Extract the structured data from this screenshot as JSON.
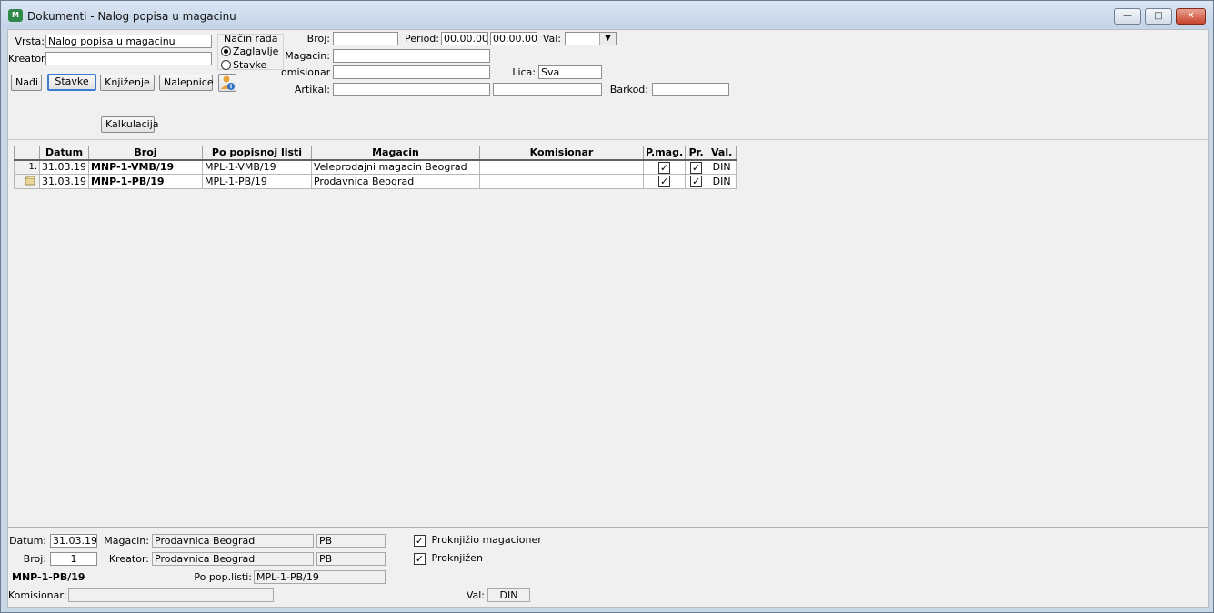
{
  "window": {
    "title": "Dokumenti - Nalog popisa u magacinu",
    "app_icon_text": "M",
    "minimize_symbol": "—",
    "maximize_symbol": "□",
    "close_symbol": "✕"
  },
  "filters": {
    "vrsta_label": "Vrsta:",
    "vrsta_value": "Nalog popisa u magacinu",
    "kreator_label": "Kreator:",
    "kreator_value": "",
    "nacin_rada_label": "Način rada",
    "mode_options": [
      "Zaglavlje",
      "Stavke"
    ],
    "mode_selected": "Zaglavlje",
    "broj_label": "Broj:",
    "broj_value": "",
    "period_label": "Period:",
    "period_from": "00.00.00",
    "period_to": "00.00.00",
    "val_label": "Val:",
    "val_value": "",
    "magacin_label": "Magacin:",
    "magacin_value": "",
    "komisionar_label": "omisionar:",
    "komisionar_value": "",
    "lica_label": "Lica:",
    "lica_value": "Sva",
    "artikal_label": "Artikal:",
    "artikal_value": "",
    "artikal_value2": "",
    "barkod_label": "Barkod:",
    "barkod_value": ""
  },
  "toolbar": {
    "nadji": "Nađi",
    "stavke": "Stavke",
    "knjizenje": "Knjiženje",
    "nalepnice": "Nalepnice",
    "kalkulacija": "Kalkulacija"
  },
  "grid": {
    "columns": [
      "",
      "Datum",
      "Broj",
      "Po popisnoj listi",
      "Magacin",
      "Komisionar",
      "P.mag.",
      "Pr.",
      "Val."
    ],
    "rows": [
      {
        "index": "1.",
        "datum": "31.03.19",
        "broj": "MNP-1-VMB/19",
        "po_listi": "MPL-1-VMB/19",
        "magacin": "Veleprodajni magacin Beograd",
        "komisionar": "",
        "pmag": "✓",
        "pr": "✓",
        "val": "DIN"
      },
      {
        "index": "2.",
        "datum": "31.03.19",
        "broj": "MNP-1-PB/19",
        "po_listi": "MPL-1-PB/19",
        "magacin": "Prodavnica Beograd",
        "komisionar": "",
        "pmag": "✓",
        "pr": "✓",
        "val": "DIN"
      }
    ]
  },
  "detail": {
    "datum_label": "Datum:",
    "datum_value": "31.03.19",
    "broj_label": "Broj:",
    "broj_value": "1",
    "doc_number": "MNP-1-PB/19",
    "komisionar_label": "Komisionar:",
    "komisionar_value": "",
    "magacin_label": "Magacin:",
    "magacin_value": "Prodavnica Beograd",
    "magacin_code": "PB",
    "kreator_label": "Kreator:",
    "kreator_value": "Prodavnica Beograd",
    "kreator_code": "PB",
    "po_pop_label": "Po pop.listi:",
    "po_pop_value": "MPL-1-PB/19",
    "proknjizio_label": "Proknjižio magacioner",
    "proknjizio_checked": "✓",
    "proknjizen_label": "Proknjižen",
    "proknjizen_checked": "✓",
    "val_label": "Val:",
    "val_value": "DIN"
  },
  "icons": [
    "app-icon",
    "minimize-icon",
    "maximize-icon",
    "close-icon",
    "user-info-icon",
    "dropdown-arrow-icon",
    "record-pointer-icon"
  ]
}
